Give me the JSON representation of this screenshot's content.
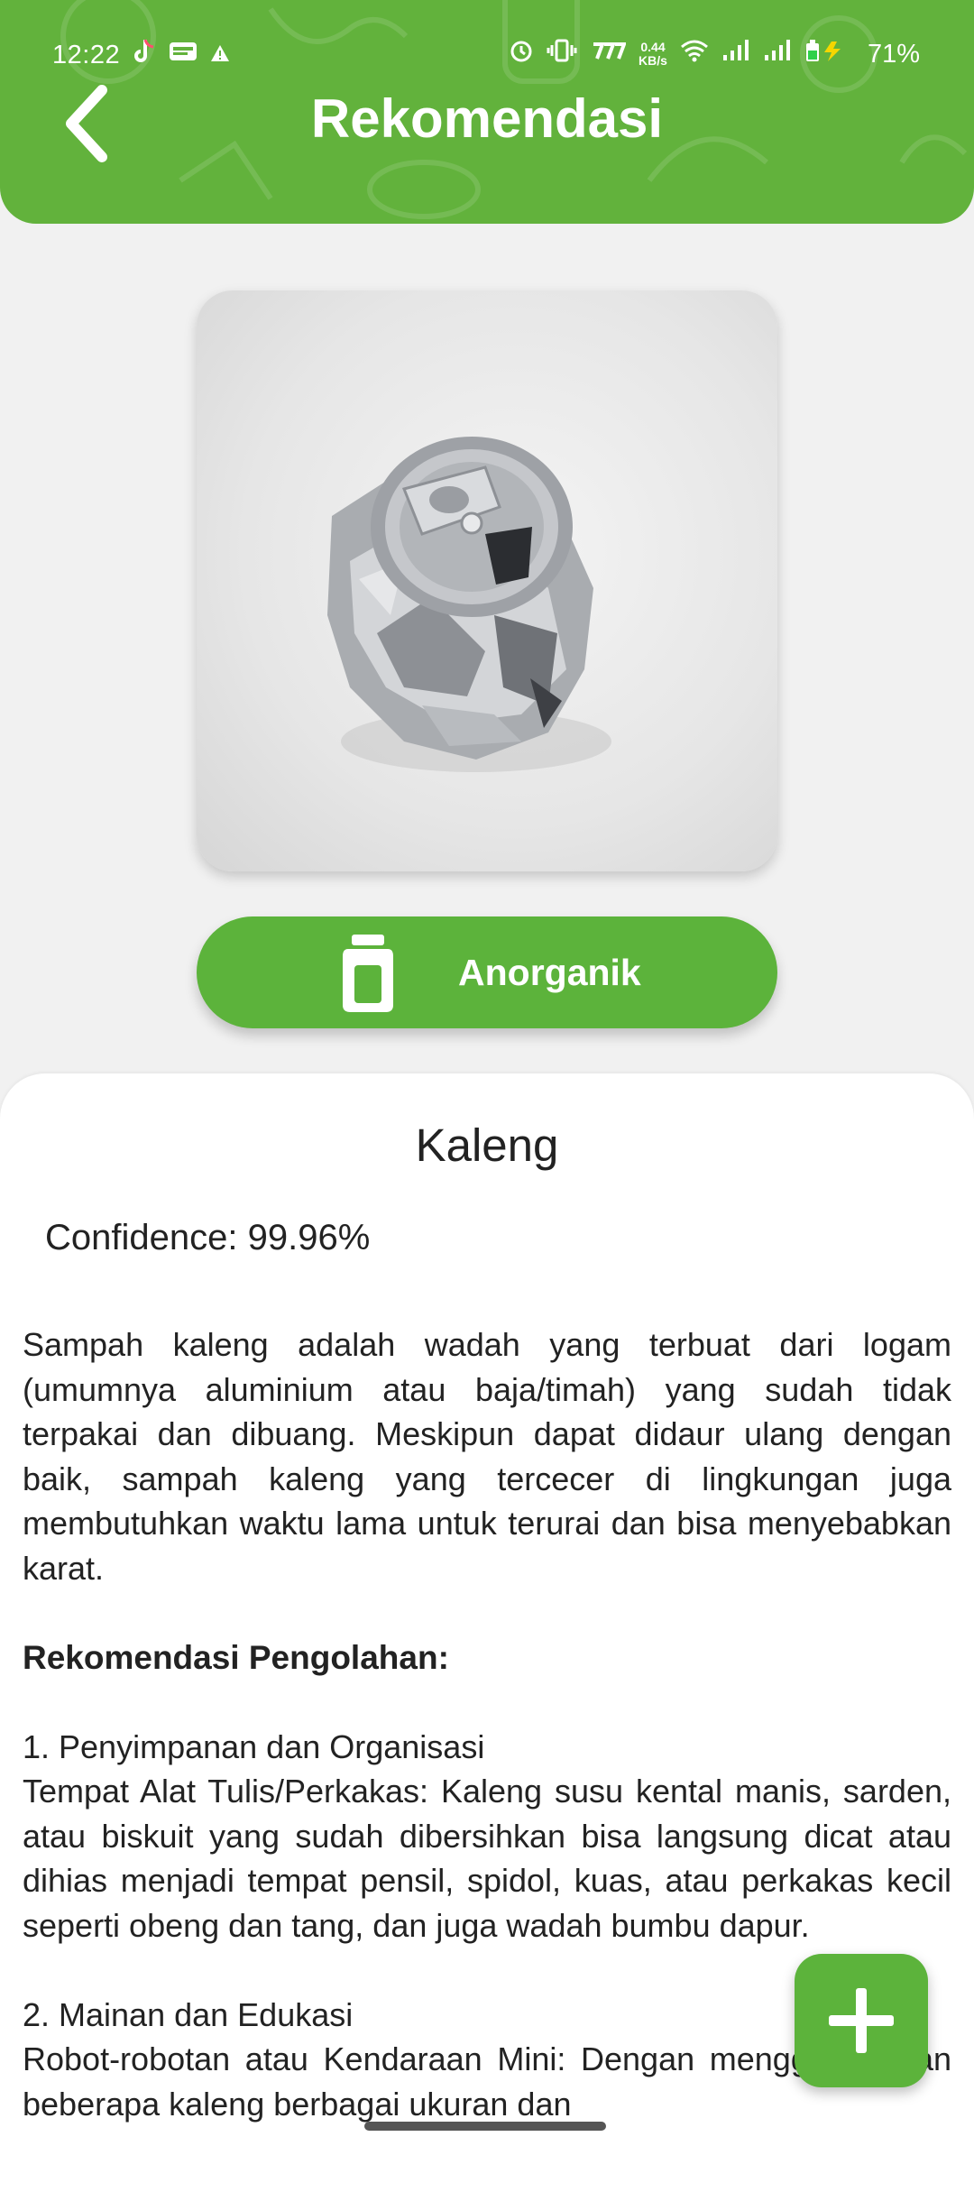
{
  "status_bar": {
    "time": "12:22",
    "net_speed_value": "0.44",
    "net_speed_unit": "KB/s",
    "battery": "71%",
    "icons": [
      "tiktok-icon",
      "webtoon-icon",
      "warning-icon",
      "alarm-icon",
      "vibrate-icon",
      "carrier-icon",
      "wifi-icon",
      "signal-icon",
      "signal-icon",
      "battery-charging-icon"
    ]
  },
  "header": {
    "title": "Rekomendasi",
    "back_icon": "chevron-left-icon",
    "color": "#62b23c"
  },
  "photo": {
    "subject": "crushed aluminium can"
  },
  "category": {
    "label": "Anorganik",
    "icon": "jar-icon",
    "color": "#5cb33b"
  },
  "result": {
    "name": "Kaleng",
    "confidence": "Confidence: 99.96%"
  },
  "content": {
    "description": "Sampah kaleng adalah wadah yang terbuat dari logam (umumnya aluminium atau baja/timah) yang sudah tidak terpakai dan dibuang. Meskipun dapat didaur ulang dengan baik, sampah kaleng yang tercecer di lingkungan juga membutuhkan waktu lama untuk terurai dan bisa menyebabkan karat.",
    "recommendation_heading": "Rekomendasi Pengolahan:",
    "sections": [
      {
        "title": "1. Penyimpanan dan Organisasi",
        "body": "Tempat Alat Tulis/Perkakas: Kaleng susu kental manis, sarden, atau biskuit yang sudah dibersihkan bisa langsung dicat atau dihias menjadi tempat pensil, spidol, kuas, atau perkakas kecil seperti obeng dan tang, dan juga wadah bumbu dapur."
      },
      {
        "title": "2. Mainan dan Edukasi",
        "body": "Robot-robotan atau Kendaraan Mini: Dengan menggabungkan beberapa kaleng berbagai ukuran dan"
      }
    ]
  },
  "fab": {
    "icon": "plus-icon"
  }
}
